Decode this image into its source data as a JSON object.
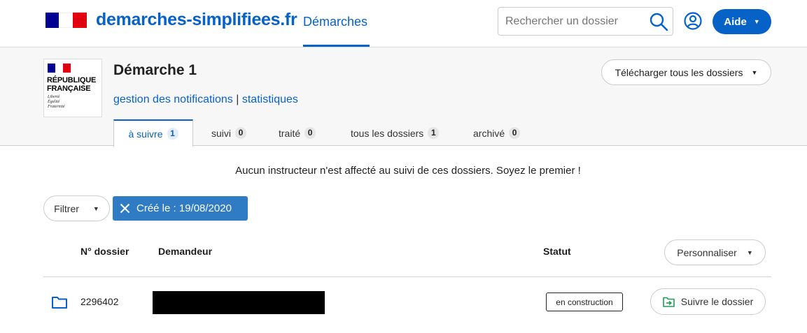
{
  "header": {
    "site_title": "demarches-simplifiees.fr",
    "nav_demarches": "Démarches",
    "search_placeholder": "Rechercher un dossier",
    "aide_label": "Aide"
  },
  "procedure": {
    "logo_text": "RÉPUBLIQUE\nFRANÇAISE",
    "logo_motto": "Liberté\nÉgalité\nFraternité",
    "title": "Démarche 1",
    "link_notifications": "gestion des notifications",
    "link_separator": "|",
    "link_stats": "statistiques",
    "download_label": "Télécharger tous les dossiers"
  },
  "tabs": [
    {
      "label": "à suivre",
      "count": "1",
      "active": true
    },
    {
      "label": "suivi",
      "count": "0"
    },
    {
      "label": "traité",
      "count": "0"
    },
    {
      "label": "tous les dossiers",
      "count": "1"
    },
    {
      "label": "archivé",
      "count": "0"
    }
  ],
  "notice": "Aucun instructeur n'est affecté au suivi de ces dossiers. Soyez le premier !",
  "filters": {
    "filter_label": "Filtrer",
    "active_filter": "Créé le : 19/08/2020"
  },
  "table": {
    "headers": {
      "dossier": "N° dossier",
      "demandeur": "Demandeur",
      "statut": "Statut"
    },
    "personnaliser_label": "Personnaliser",
    "rows": [
      {
        "number": "2296402",
        "status": "en construction",
        "action": "Suivre le dossier"
      }
    ]
  },
  "colors": {
    "brand_blue": "#0762c8",
    "chip_blue": "#2f7bc4",
    "flag_blue": "#000091",
    "flag_red": "#e1000f"
  }
}
